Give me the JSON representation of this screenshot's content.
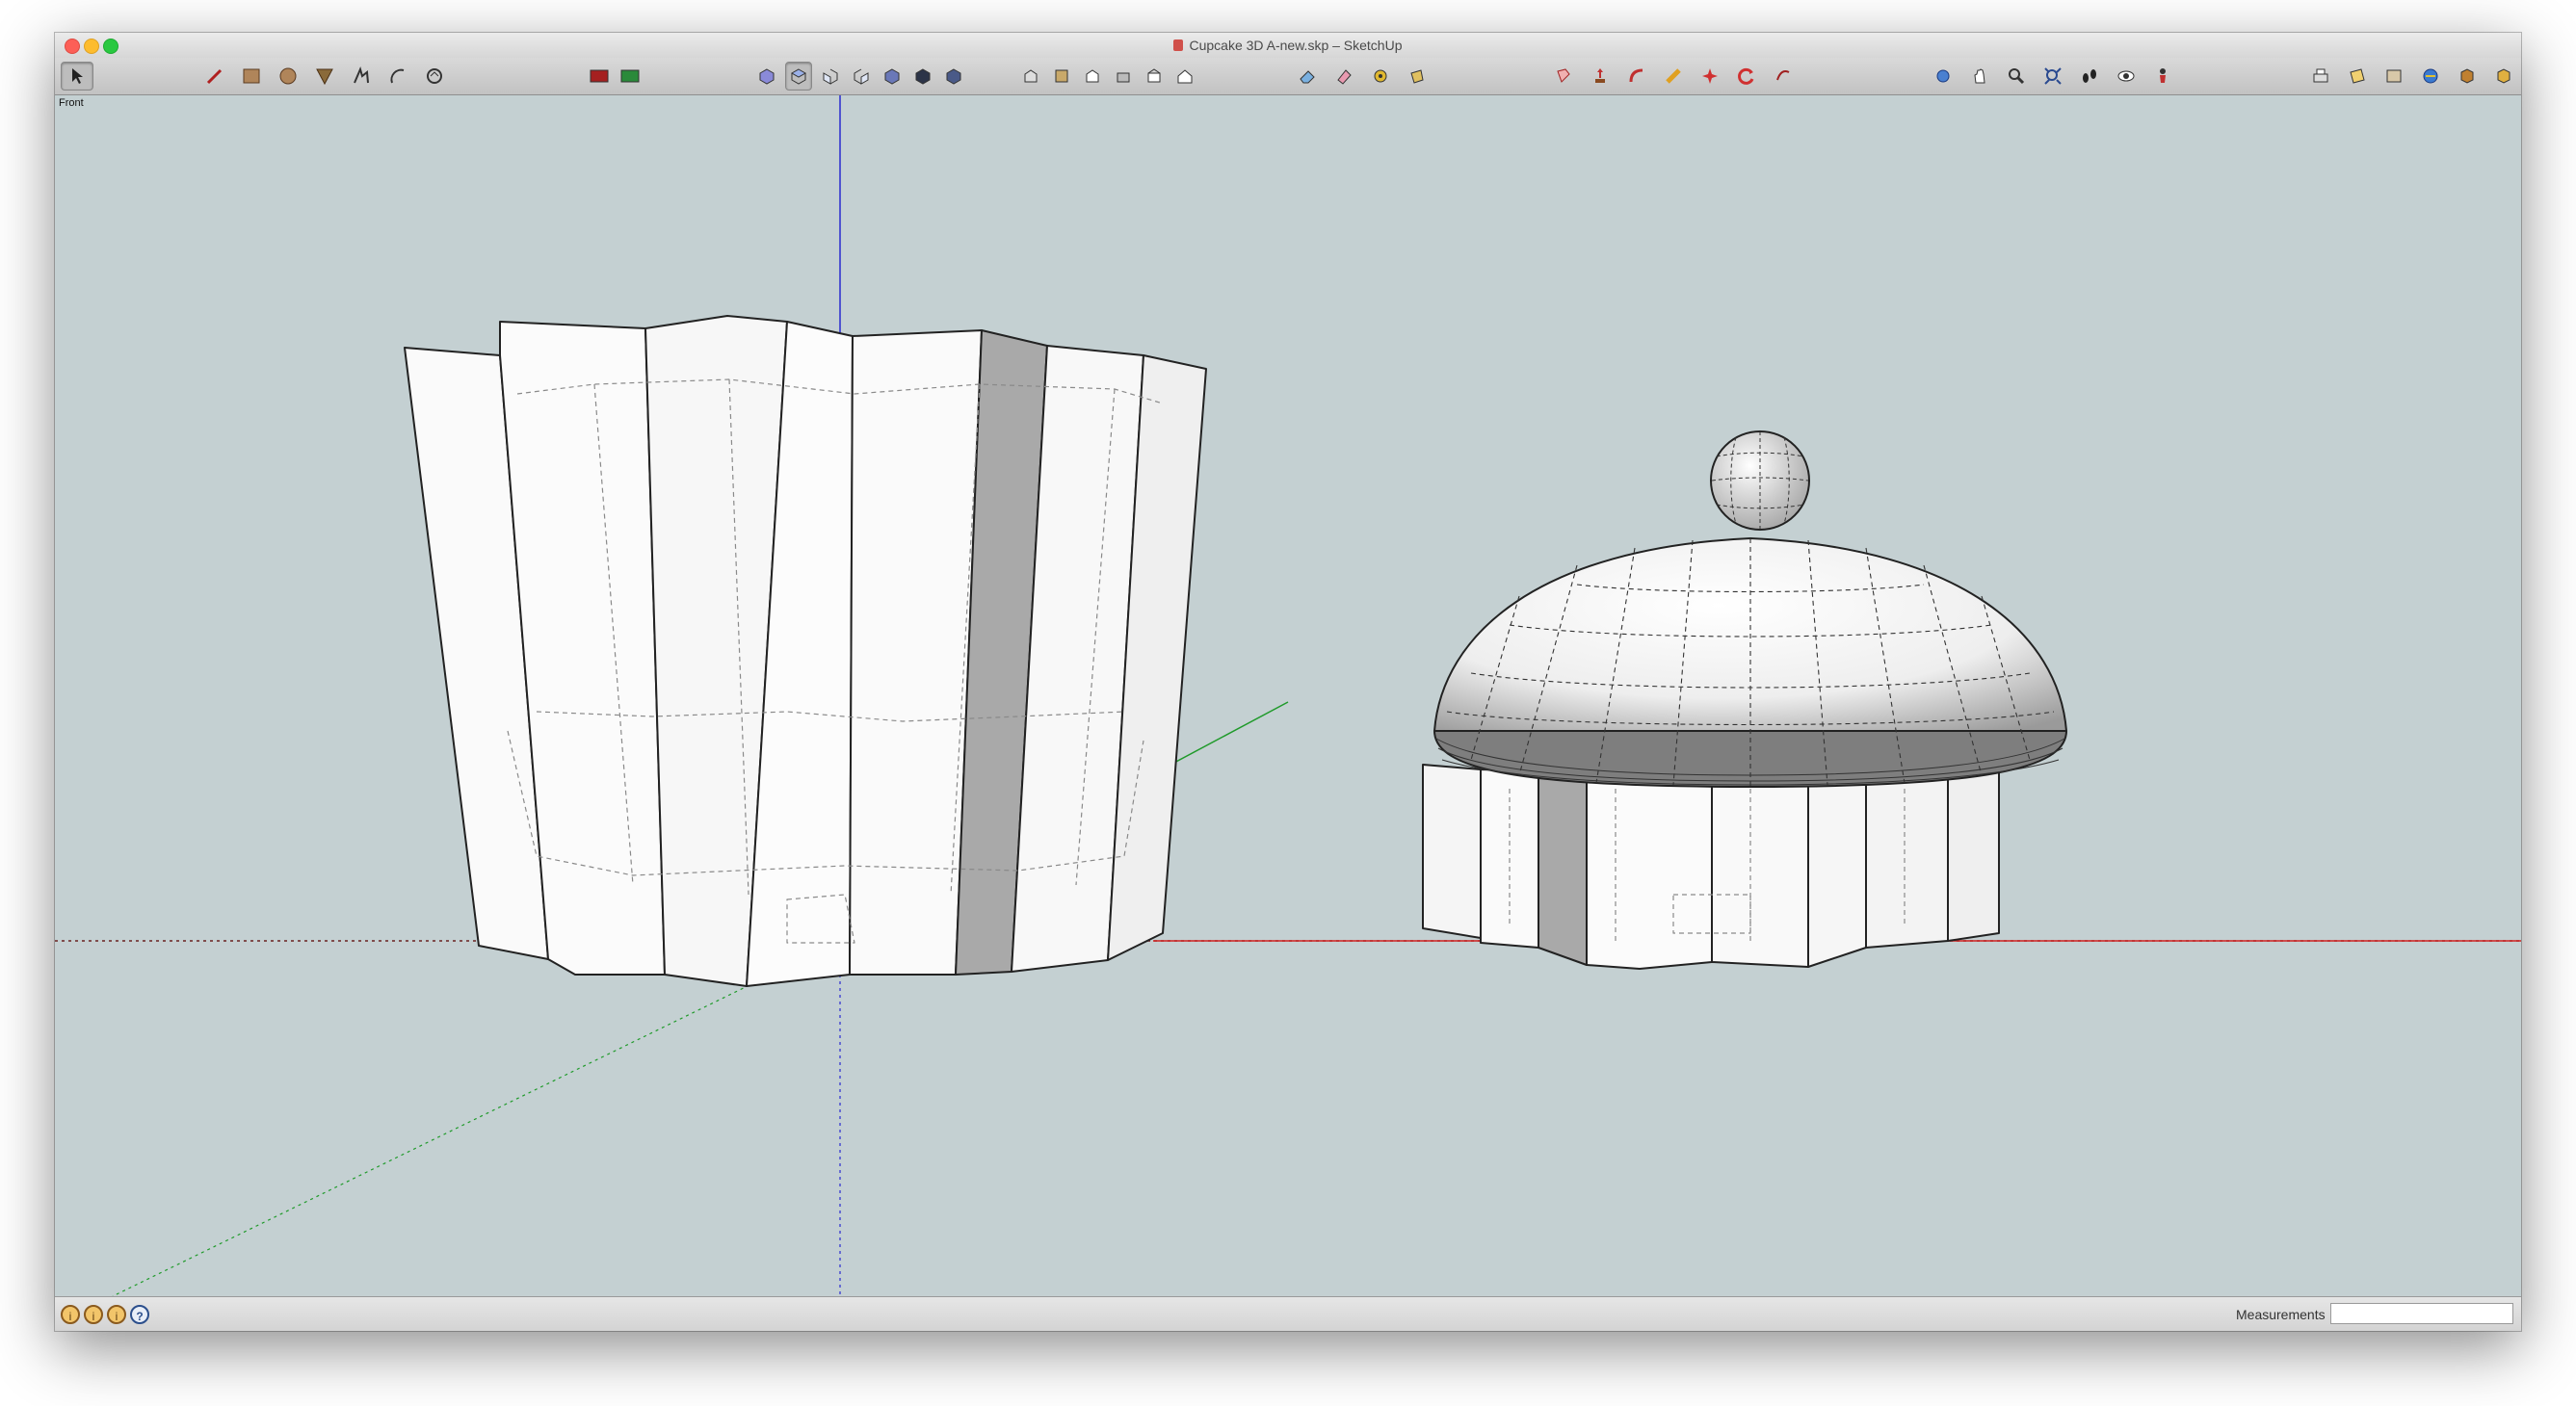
{
  "window": {
    "title": "Cupcake 3D A-new.skp – SketchUp"
  },
  "toolbar": {
    "select": "select-tool",
    "drawing": [
      "pencil-icon",
      "rectangle-icon",
      "circle-icon",
      "polygon-icon",
      "freehand-icon",
      "arc-icon",
      "rotate-rect-icon"
    ],
    "layer_buttons": [
      "layer-toggle-icon",
      "layer-new-icon"
    ],
    "views": [
      "iso-view-icon",
      "top-view-icon",
      "front-view-icon",
      "right-view-icon",
      "back-view-icon",
      "left-view-icon",
      "bottom-view-icon"
    ],
    "styles": [
      "xray-icon",
      "wireframe-icon",
      "hidden-line-icon",
      "shaded-icon",
      "shaded-texture-icon"
    ],
    "edit": [
      "eraser-icon",
      "paint-icon",
      "tape-icon",
      "bucket-icon"
    ],
    "modify": [
      "push-pull-icon",
      "move-icon",
      "follow-me-icon",
      "offset-icon",
      "scale-icon",
      "rotate-icon",
      "intersect-icon"
    ],
    "camera": [
      "orbit-icon",
      "pan-icon",
      "zoom-icon",
      "zoom-extents-icon",
      "walk-icon",
      "look-around-icon",
      "position-camera-icon"
    ],
    "warehouse": [
      "print-icon",
      "model-info-icon",
      "components-icon",
      "3d-warehouse-icon",
      "extension-icon",
      "share-icon",
      "preferences-icon"
    ]
  },
  "viewport": {
    "scene_name": "Front",
    "background": "#c4d0d2",
    "axis_colors": {
      "red": "#d02020",
      "green": "#1f9a2a",
      "blue": "#2a2ad0"
    }
  },
  "statusbar": {
    "icons": [
      "geo-location-icon",
      "credits-icon",
      "instructor-icon",
      "help-icon"
    ],
    "measurements_label": "Measurements",
    "measurements_value": ""
  }
}
